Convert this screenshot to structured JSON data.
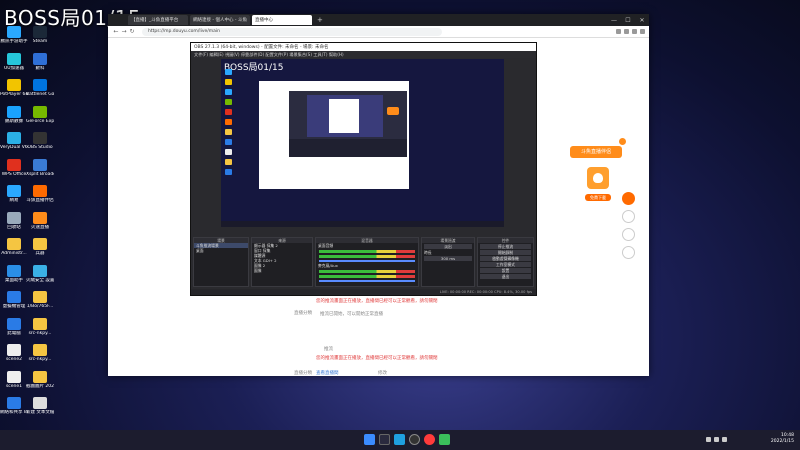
{
  "overlay_title": "BOSS局01/15",
  "desktop_icons": [
    {
      "label": "騰訊手游助手",
      "color": "#2aa8ff"
    },
    {
      "label": "Steam",
      "color": "#1b2838"
    },
    {
      "label": "UU加速器",
      "color": "#26c6da"
    },
    {
      "label": "數科",
      "color": "#2f6fd6"
    },
    {
      "label": "PotPlayer 64 bit",
      "color": "#f2c400"
    },
    {
      "label": "Battlenet Games L...",
      "color": "#0074e0"
    },
    {
      "label": "鵝斯數據",
      "color": "#1aa3ff"
    },
    {
      "label": "GeForce Experience",
      "color": "#76b900"
    },
    {
      "label": "VeryDual V6 直播伴侶",
      "color": "#2bb0e6"
    },
    {
      "label": "OBS Studio",
      "color": "#333"
    },
    {
      "label": "WPS Office",
      "color": "#e0301e"
    },
    {
      "label": "Xsplit Broadcaster",
      "color": "#3a7bd5"
    },
    {
      "label": "網易",
      "color": "#2aa8ff"
    },
    {
      "label": "斗魚直播伴侶",
      "color": "#ff6a00"
    },
    {
      "label": "回收站",
      "color": "#9ab"
    },
    {
      "label": "火速直播",
      "color": "#ff8c1a"
    },
    {
      "label": "Administr...",
      "color": "#f5c542"
    },
    {
      "label": "兵器",
      "color": "#f5c542"
    },
    {
      "label": "桌面助手",
      "color": "#2a8ee6"
    },
    {
      "label": "火絨安全 設置",
      "color": "#3ab0e6"
    },
    {
      "label": "虛擬機管理",
      "color": "#2a7be6"
    },
    {
      "label": "1/Bo/765F...",
      "color": "#f5c542"
    },
    {
      "label": "此電腦",
      "color": "#2a7be6"
    },
    {
      "label": "src-nkpy...",
      "color": "#f5c542"
    },
    {
      "label": "scene2",
      "color": "#eee"
    },
    {
      "label": "src-nkpy...",
      "color": "#f5c542"
    },
    {
      "label": "scene1",
      "color": "#eee"
    },
    {
      "label": "截圖圖片 202201...",
      "color": "#f5c542"
    },
    {
      "label": "網絡和共享 Internet",
      "color": "#2a7be6"
    },
    {
      "label": "新建 文本文檔",
      "color": "#ddd"
    }
  ],
  "browser": {
    "tabs": [
      {
        "label": "【直播】_斗魚直播平台",
        "active": false
      },
      {
        "label": "網絡連接 - 個人中心 - 斗魚",
        "active": false
      },
      {
        "label": "直播中心",
        "active": true
      }
    ],
    "url": "https://mp.douyu.com/live/main",
    "win_controls": [
      "—",
      "☐",
      "✕"
    ]
  },
  "page_texts": {
    "warn1": "您的推流畫面正在播放，直播間已經可以正常觀看，請勿關閉",
    "label1": "直播分類",
    "sub1": "推流已開始，可以開始正常直播",
    "label2": "推流",
    "warn2": "您的推流畫面正在播放，直播間已經可以正常觀看，請勿關閉",
    "label3": "直播分類",
    "link": "查看直播間",
    "hint": "修改"
  },
  "promo": {
    "banner": "斗魚直播伴侶",
    "button": "免費下載"
  },
  "obs": {
    "title": "OBS 27.1.3 (64-bit, windows) - 配置文件: 未命名 - 場景: 未命名",
    "menu": "文件(F)  編輯(E)  視圖(V)  停靠部件(D)  配置文件(P)  場景集合(S)  工具(T)  幫助(H)",
    "preview_title": "BOSS局01/15",
    "docks": {
      "scenes_header": "場景",
      "scenes": [
        "斗魚推流場景",
        "桌面"
      ],
      "sources_header": "來源",
      "sources": [
        "顯示器 採集 2",
        "窗口 採集",
        "媒體源",
        "文本 GDI+ 2",
        "圖像 2",
        "圖像"
      ],
      "mixer_header": "混音器",
      "mixer_channels": [
        "桌面音頻",
        "麥克風/Aux"
      ],
      "transition_header": "場景過渡",
      "transition_select": "淡出",
      "transition_duration": "300 ms",
      "transition_label": "時長",
      "controls_header": "控件",
      "controls": [
        "停止推流",
        "開始錄制",
        "啟動虛擬攝像機",
        "工作室模式",
        "設置",
        "退出"
      ]
    },
    "status": "LIVE: 00:00:00  REC: 00:00:00  CPU: 8.4%, 30.00 fps"
  },
  "taskbar": {
    "time": "10:48",
    "date": "2022/1/15"
  }
}
